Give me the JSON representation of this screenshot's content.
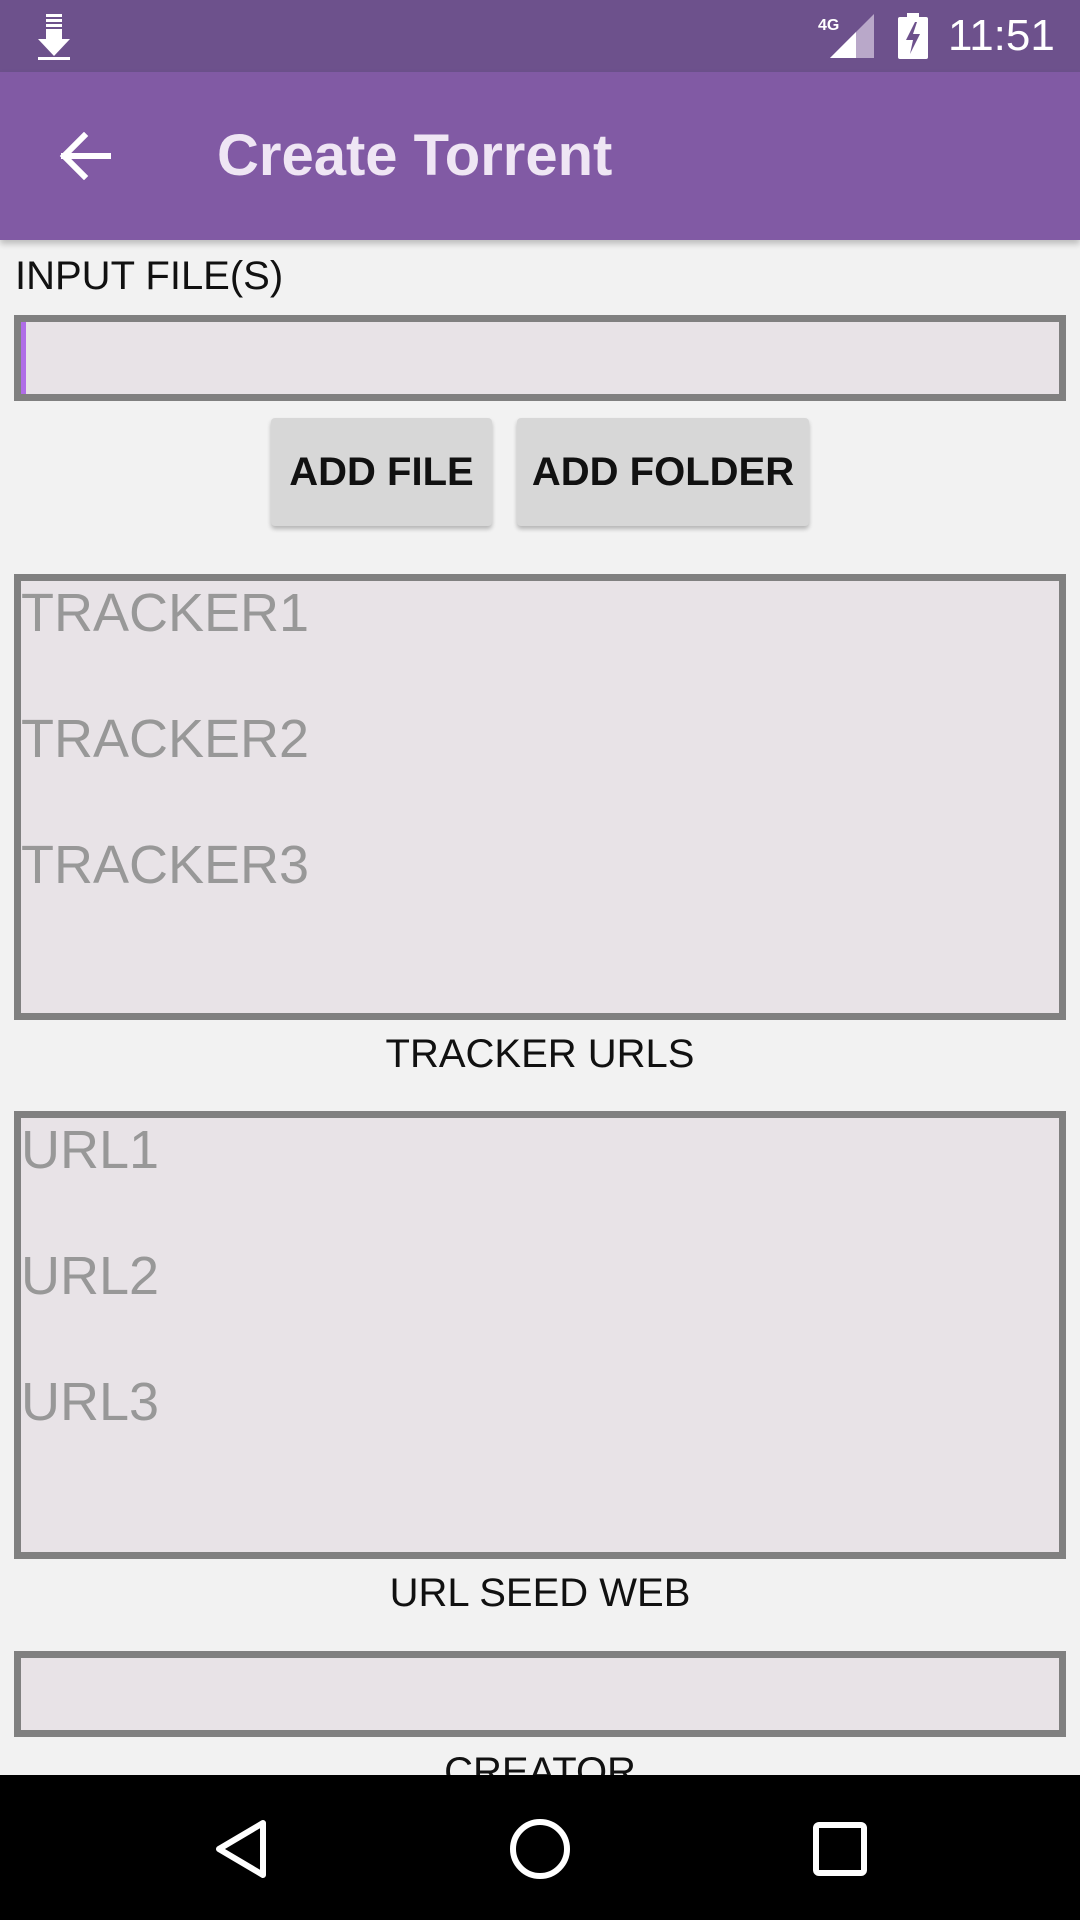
{
  "status_bar": {
    "time": "11:51",
    "network_label": "4G",
    "icons": {
      "download": "download-icon",
      "signal": "signal-icon",
      "battery": "battery-charging-icon"
    }
  },
  "app_bar": {
    "title": "Create Torrent",
    "back_icon": "arrow-back-icon"
  },
  "form": {
    "input_files_label": "INPUT FILE(S)",
    "input_files_value": "",
    "add_file_label": "ADD FILE",
    "add_folder_label": "ADD FOLDER",
    "tracker_placeholder_lines": [
      "TRACKER1",
      "TRACKER2",
      "TRACKER3"
    ],
    "tracker_label": "TRACKER URLS",
    "url_seed_placeholder_lines": [
      "URL1",
      "URL2",
      "URL3"
    ],
    "url_seed_label": "URL SEED WEB",
    "creator_value": "",
    "creator_label": "CREATOR"
  },
  "nav_bar": {
    "back": "nav-back-icon",
    "home": "nav-home-icon",
    "recents": "nav-recents-icon"
  },
  "colors": {
    "status_bar": "#6d518c",
    "app_bar": "#815aa4",
    "title_text": "#efe6f4",
    "background": "#f2f2f2",
    "field_bg": "#e8e3e7",
    "field_border": "#808080",
    "cursor": "#b06de8",
    "button_bg": "#d7d7d7"
  }
}
